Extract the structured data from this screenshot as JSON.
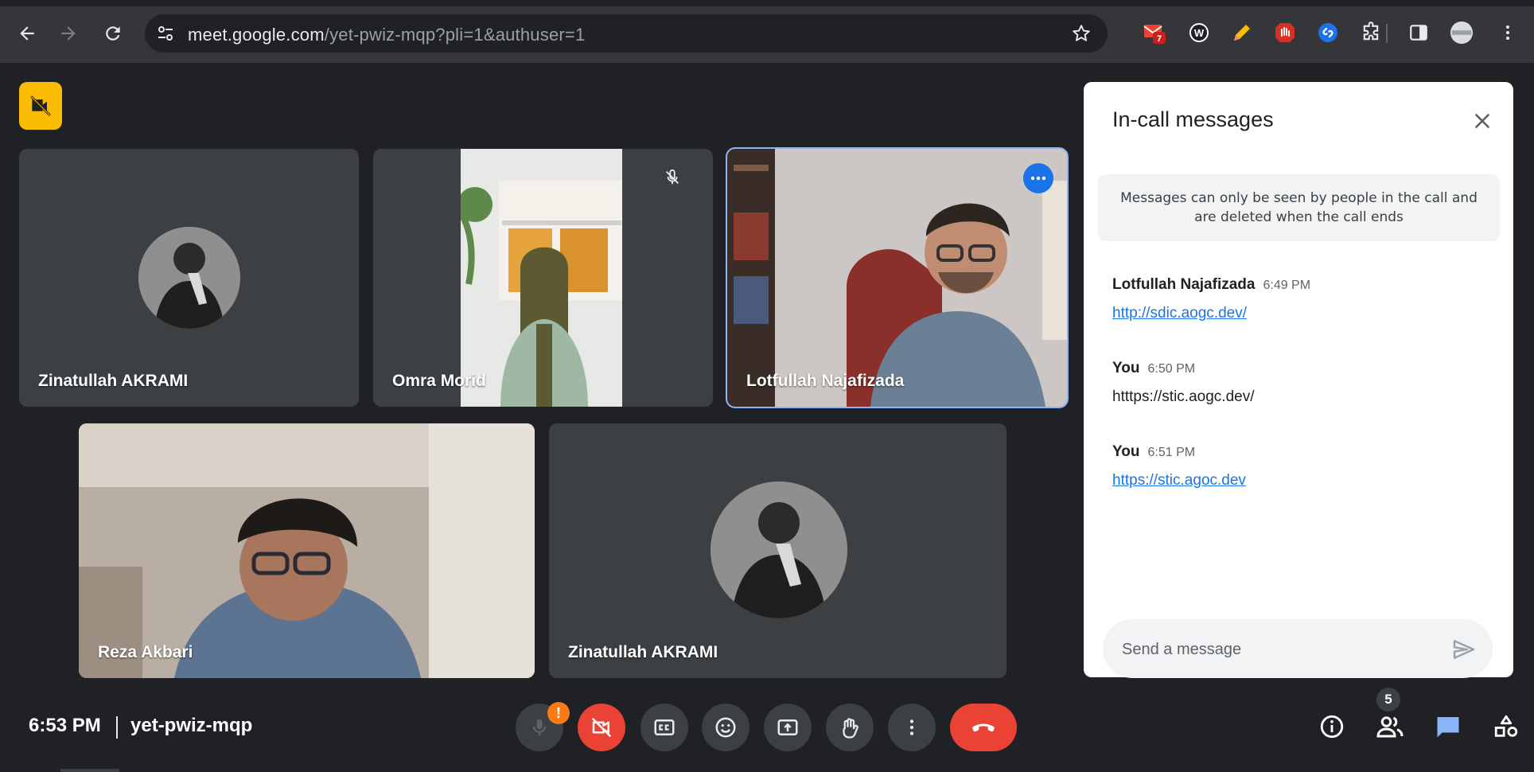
{
  "browser": {
    "url_host": "meet.google.com",
    "url_path": "/yet-pwiz-mqp?pli=1&authuser=1",
    "extensions": [
      {
        "name": "gmail-extension",
        "badge": "7"
      },
      {
        "name": "w-extension",
        "glyph": "W"
      }
    ]
  },
  "tiles": [
    {
      "name": "Zinatullah AKRAMI"
    },
    {
      "name": "Omra Morid"
    },
    {
      "name": "Lotfullah Najafizada"
    },
    {
      "name": "Reza Akbari"
    },
    {
      "name": "Zinatullah AKRAMI"
    }
  ],
  "panel": {
    "title": "In-call messages",
    "notice": "Messages can only be seen by people in the call and are deleted when the call ends",
    "messages": [
      {
        "sender": "Lotfullah Najafizada",
        "time": "6:49 PM",
        "text": "http://sdic.aogc.dev/"
      },
      {
        "sender": "You",
        "time": "6:50 PM",
        "text": "htttps://stic.aogc.dev/"
      },
      {
        "sender": "You",
        "time": "6:51 PM",
        "text": "https://stic.agoc.dev"
      }
    ],
    "compose_placeholder": "Send a message"
  },
  "bottom": {
    "time": "6:53 PM",
    "meeting_code": "yet-pwiz-mqp",
    "mic_warning": "!",
    "participant_count": "5"
  },
  "colors": {
    "accent_blue": "#1a73e8",
    "danger_red": "#ea4335",
    "warning_orange": "#fa7b17",
    "cam_off_yellow": "#fbbc04",
    "active_outline": "#8ab4f8"
  }
}
